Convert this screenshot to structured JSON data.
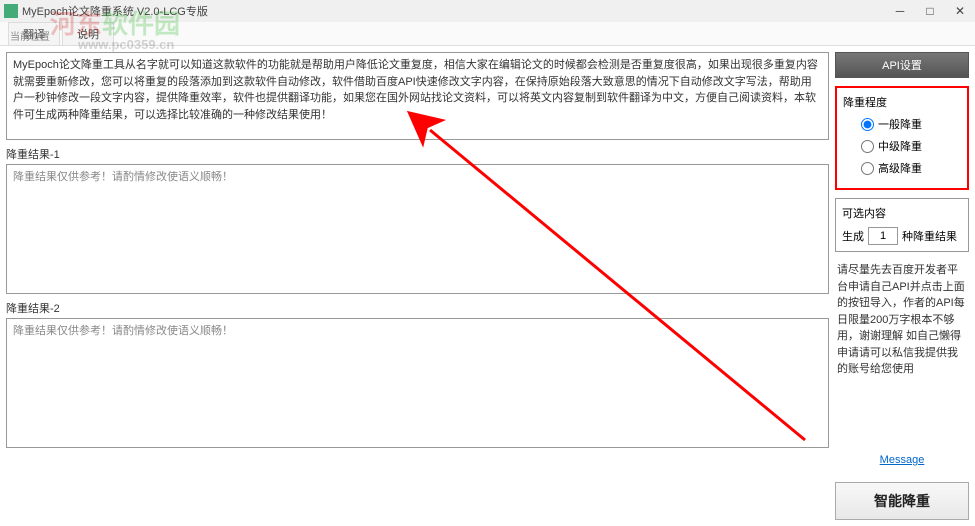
{
  "window": {
    "title": "MyEpoch论文降重系统 V2.0-LCG专版"
  },
  "watermark": {
    "line1a": "河东",
    "line1b": "软件园",
    "line2": "www.pc0359.cn"
  },
  "context_label": "当前位置",
  "tabs": {
    "tab1": "翻译",
    "tab2": "说明"
  },
  "input_text": "MyEpoch论文降重工具从名字就可以知道这款软件的功能就是帮助用户降低论文重复度，相信大家在编辑论文的时候都会检测是否重复度很高，如果出现很多重复内容就需要重新修改，您可以将重复的段落添加到这款软件自动修改，软件借助百度API快速修改文字内容，在保持原始段落大致意思的情况下自动修改文字写法，帮助用户一秒钟修改一段文字内容，提供降重效率，软件也提供翻译功能，如果您在国外网站找论文资料，可以将英文内容复制到软件翻译为中文，方便自己阅读资料，本软件可生成两种降重结果，可以选择比较准确的一种修改结果使用！",
  "result1": {
    "label": "降重结果-1",
    "placeholder": "降重结果仅供参考！请酌情修改使语义顺畅！"
  },
  "result2": {
    "label": "降重结果-2",
    "placeholder": "降重结果仅供参考！请酌情修改使语义顺畅！"
  },
  "api_button": "API设置",
  "degree_panel": {
    "title": "降重程度",
    "opt1": "一般降重",
    "opt2": "中级降重",
    "opt3": "高级降重"
  },
  "optional_panel": {
    "title": "可选内容",
    "gen_label": "生成",
    "gen_value": "1",
    "gen_suffix": "种降重结果"
  },
  "info_text": "请尽量先去百度开发者平台申请自己API并点击上面的按钮导入，作者的API每日限量200万字根本不够用，谢谢理解\n如自己懒得申请请可以私信我提供我的账号给您使用",
  "message_link": "Message",
  "smart_button": "智能降重"
}
